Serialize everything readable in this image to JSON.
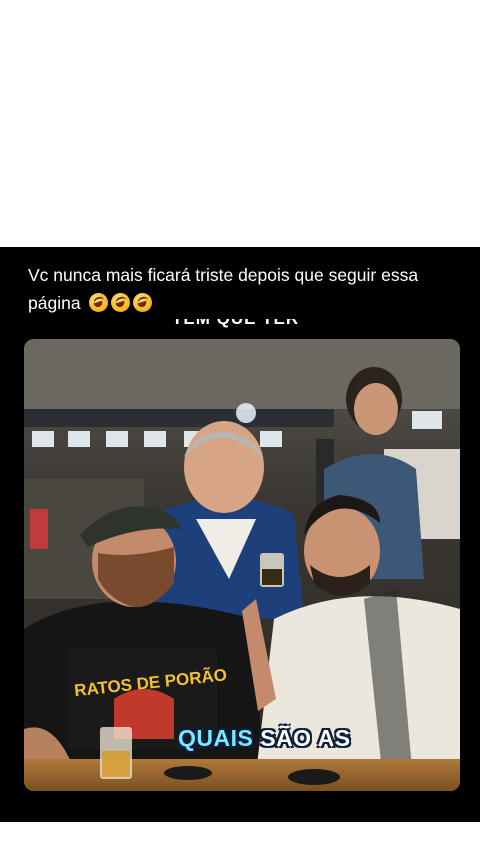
{
  "post": {
    "caption": "Vc nunca mais ficará triste depois que seguir essa página",
    "caption_emojis": [
      "rolling-on-floor-laughing",
      "rolling-on-floor-laughing",
      "rolling-on-floor-laughing"
    ],
    "overlay_top_text": "TEM QUE TER",
    "subtitle_highlight": "QUAIS",
    "subtitle_rest": "SÃO AS",
    "shirt_print": "RATOS DE PORÃO"
  },
  "colors": {
    "background": "#000000",
    "page": "#ffffff",
    "subtitle_highlight": "#7fe6ff"
  }
}
